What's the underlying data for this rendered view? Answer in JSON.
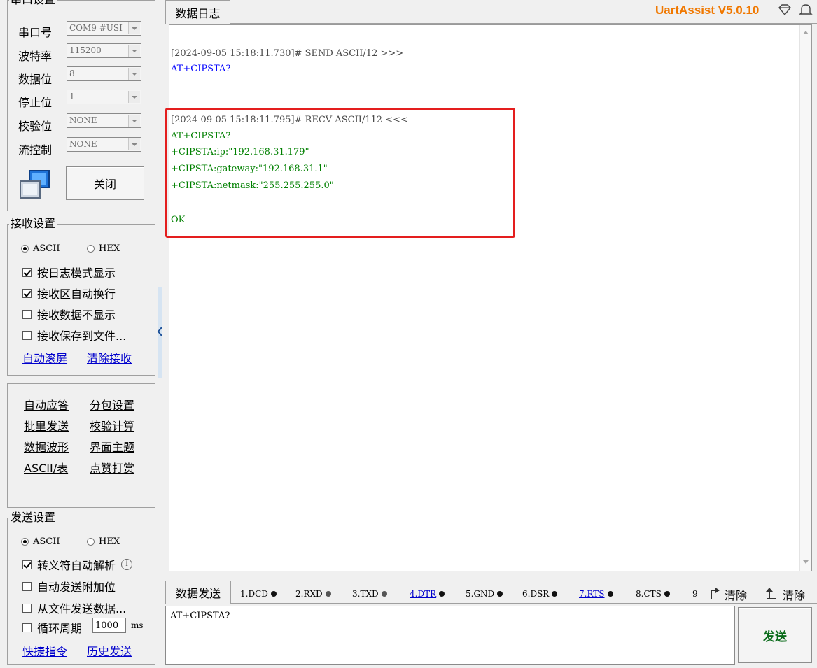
{
  "serial": {
    "legend": "串口设置",
    "port": {
      "label": "串口号",
      "value": "COM9 #USI"
    },
    "baud": {
      "label": "波特率",
      "value": "115200"
    },
    "databits": {
      "label": "数据位",
      "value": "8"
    },
    "stopbits": {
      "label": "停止位",
      "value": "1"
    },
    "parity": {
      "label": "校验位",
      "value": "NONE"
    },
    "flow": {
      "label": "流控制",
      "value": "NONE"
    },
    "close_button": "关闭"
  },
  "receive": {
    "legend": "接收设置",
    "ascii": "ASCII",
    "hex": "HEX",
    "opt_log_mode": "按日志模式显示",
    "opt_auto_wrap": "接收区自动换行",
    "opt_hide": "接收数据不显示",
    "opt_save_file": "接收保存到文件...",
    "auto_scroll": "自动滚屏",
    "clear_recv": "清除接收"
  },
  "tools": {
    "auto_reply": "自动应答",
    "packet": "分包设置",
    "batch_send": "批里发送",
    "checksum": "校验计算",
    "waveform": "数据波形",
    "theme": "界面主题",
    "ascii_table": "ASCII/表",
    "donate": "点赞打赏"
  },
  "send_settings": {
    "legend": "发送设置",
    "ascii": "ASCII",
    "hex": "HEX",
    "opt_escape": "转义符自动解析",
    "opt_append": "自动发送附加位",
    "opt_from_file": "从文件发送数据...",
    "opt_cycle": "循环周期",
    "cycle_value": "1000",
    "cycle_unit": "ms",
    "shortcuts": "快捷指令",
    "history": "历史发送"
  },
  "header": {
    "log_tab": "数据日志",
    "app_version": "UartAssist V5.0.10"
  },
  "log": {
    "lines": [
      {
        "text": "[2024-09-05 15:18:11.730]# SEND ASCII/12 >>>",
        "color": "gray"
      },
      {
        "text": "AT+CIPSTA?",
        "color": "blue"
      },
      {
        "text": "[2024-09-05 15:18:11.795]# RECV ASCII/112 <<<",
        "color": "gray"
      },
      {
        "text": "AT+CIPSTA?",
        "color": "green"
      },
      {
        "text": "+CIPSTA:ip:\"192.168.31.179\"",
        "color": "green"
      },
      {
        "text": "+CIPSTA:gateway:\"192.168.31.1\"",
        "color": "green"
      },
      {
        "text": "+CIPSTA:netmask:\"255.255.255.0\"",
        "color": "green"
      },
      {
        "text": "OK",
        "color": "green"
      }
    ]
  },
  "send": {
    "tab": "数据发送",
    "pins": [
      "1.DCD",
      "2.RXD",
      "3.TXD",
      "4.DTR",
      "5.GND",
      "6.DSR",
      "7.RTS",
      "8.CTS",
      "9"
    ],
    "clear1": "清除",
    "clear2": "清除",
    "input_value": "AT+CIPSTA?",
    "send_button": "发送"
  },
  "colors": {
    "highlight_box": "#e41e1e",
    "version_link": "#f07800"
  }
}
